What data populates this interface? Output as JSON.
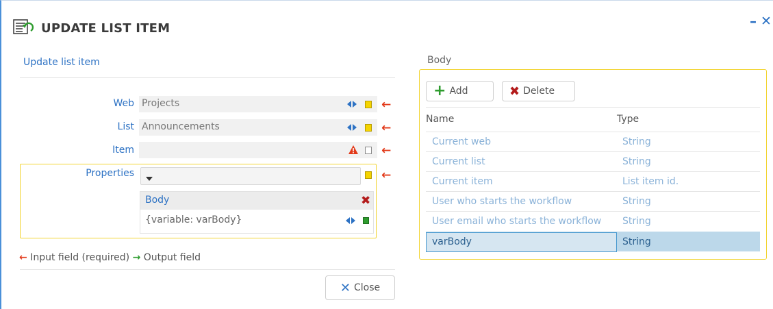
{
  "dialog": {
    "title": "UPDATE LIST ITEM",
    "minimize_icon": "minimize-icon",
    "close_icon": "close-icon"
  },
  "left": {
    "section_title": "Update list item",
    "fields": [
      {
        "label": "Web",
        "value": "Projects"
      },
      {
        "label": "List",
        "value": "Announcements"
      },
      {
        "label": "Item",
        "value": ""
      },
      {
        "label": "Properties",
        "value": ""
      }
    ],
    "body_panel": {
      "title": "Body",
      "value": "{variable: varBody}"
    },
    "legend": {
      "input_arrow": "←",
      "input_label": "Input field (required)",
      "output_arrow": "→",
      "output_label": "Output field"
    },
    "close_button": "Close"
  },
  "right": {
    "title": "Body",
    "add_button": "Add",
    "delete_button": "Delete",
    "columns": [
      "Name",
      "Type"
    ],
    "rows": [
      {
        "name": "Current web",
        "type": "String"
      },
      {
        "name": "Current list",
        "type": "String"
      },
      {
        "name": "Current item",
        "type": "List item id."
      },
      {
        "name": "User who starts the workflow",
        "type": "String"
      },
      {
        "name": "User email who starts the workflow",
        "type": "String"
      },
      {
        "name": "varBody",
        "type": "String"
      }
    ]
  },
  "colors": {
    "accent": "#2d72c4",
    "group_border": "#f2d431",
    "required_arrow": "#e23a1a",
    "output_arrow": "#2e9c2e",
    "selected_row": "#bcd8ea"
  }
}
